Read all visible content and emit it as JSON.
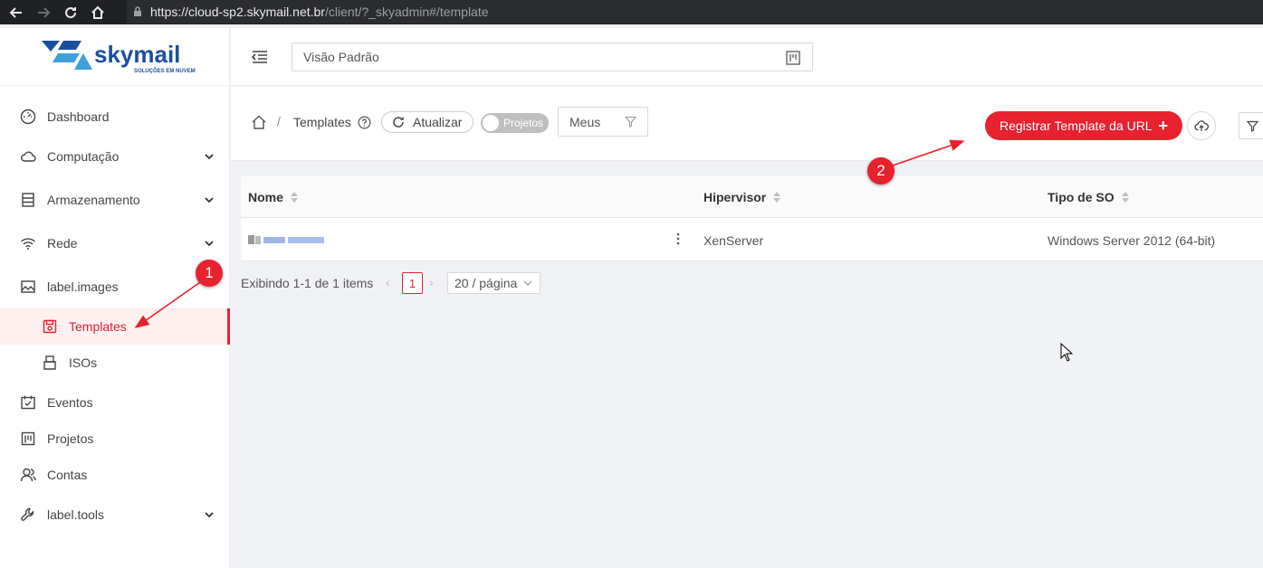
{
  "browser": {
    "url_host": "https://cloud-sp2.skymail.net.br",
    "url_path": "/client/?_skyadmin#/template"
  },
  "logo": {
    "name": "skymail",
    "tagline": "SOLUÇÕES EM NUVEM"
  },
  "sidebar": {
    "items": [
      {
        "label": "Dashboard",
        "icon": "dashboard-icon"
      },
      {
        "label": "Computação",
        "icon": "cloud-icon"
      },
      {
        "label": "Armazenamento",
        "icon": "database-icon"
      },
      {
        "label": "Rede",
        "icon": "wifi-icon"
      },
      {
        "label": "label.images",
        "icon": "picture-icon"
      },
      {
        "label": "Templates",
        "icon": "save-icon"
      },
      {
        "label": "ISOs",
        "icon": "usb-icon"
      },
      {
        "label": "Eventos",
        "icon": "schedule-icon"
      },
      {
        "label": "Projetos",
        "icon": "project-icon"
      },
      {
        "label": "Contas",
        "icon": "team-icon"
      },
      {
        "label": "label.tools",
        "icon": "tool-icon"
      }
    ]
  },
  "header": {
    "view_selector": "Visão Padrão"
  },
  "toolbar": {
    "breadcrumb": "Templates",
    "refresh_label": "Atualizar",
    "projects_toggle_label": "Projetos",
    "filter_select_value": "Meus",
    "register_button_label": "Registrar Template da URL"
  },
  "table": {
    "columns": [
      "Nome",
      "Hipervisor",
      "Tipo de SO"
    ],
    "rows": [
      {
        "hypervisor": "XenServer",
        "os_type": "Windows Server 2012 (64-bit)"
      }
    ]
  },
  "pagination": {
    "info": "Exibindo 1-1 de 1 items",
    "current_page": "1",
    "page_size": "20 / página"
  },
  "annotations": {
    "badge1": "1",
    "badge2": "2"
  },
  "colors": {
    "accent": "#e8212f",
    "logo_blue": "#1a4fa0",
    "logo_light": "#3fa0dc"
  }
}
